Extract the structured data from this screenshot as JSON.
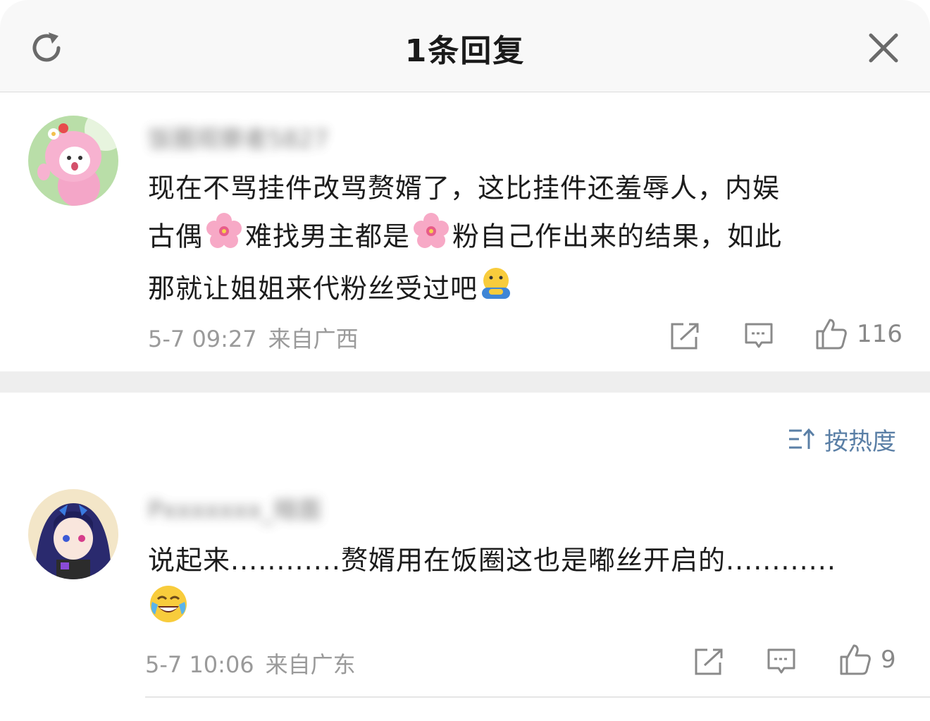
{
  "header": {
    "title": "1条回复",
    "refresh_icon": "refresh-icon",
    "close_icon": "close-icon"
  },
  "main_comment": {
    "username": "饭圈观察者5827",
    "text_lines": [
      "现在不骂挂件改骂赘婿了，这比挂件还羞辱人，内娱",
      "古偶",
      "难找男主都是",
      "粉自己作出来的结果，如此",
      "那就让姐姐来代粉丝受过吧"
    ],
    "date": "5-7 09:27",
    "location": "来自广西",
    "like_count": "116"
  },
  "sort": {
    "label": "按热度",
    "icon": "sort-icon"
  },
  "reply": {
    "username": "Pxxxxxxx_暗面",
    "text_line1": "说起来............赘婿用在饭圈这也是嘟丝开启的............",
    "date": "5-7 10:06",
    "location": "来自广东",
    "like_count": "9"
  },
  "colors": {
    "accent": "#5a7fa6",
    "meta": "#9a9a9a",
    "separator": "#eeeeee"
  }
}
